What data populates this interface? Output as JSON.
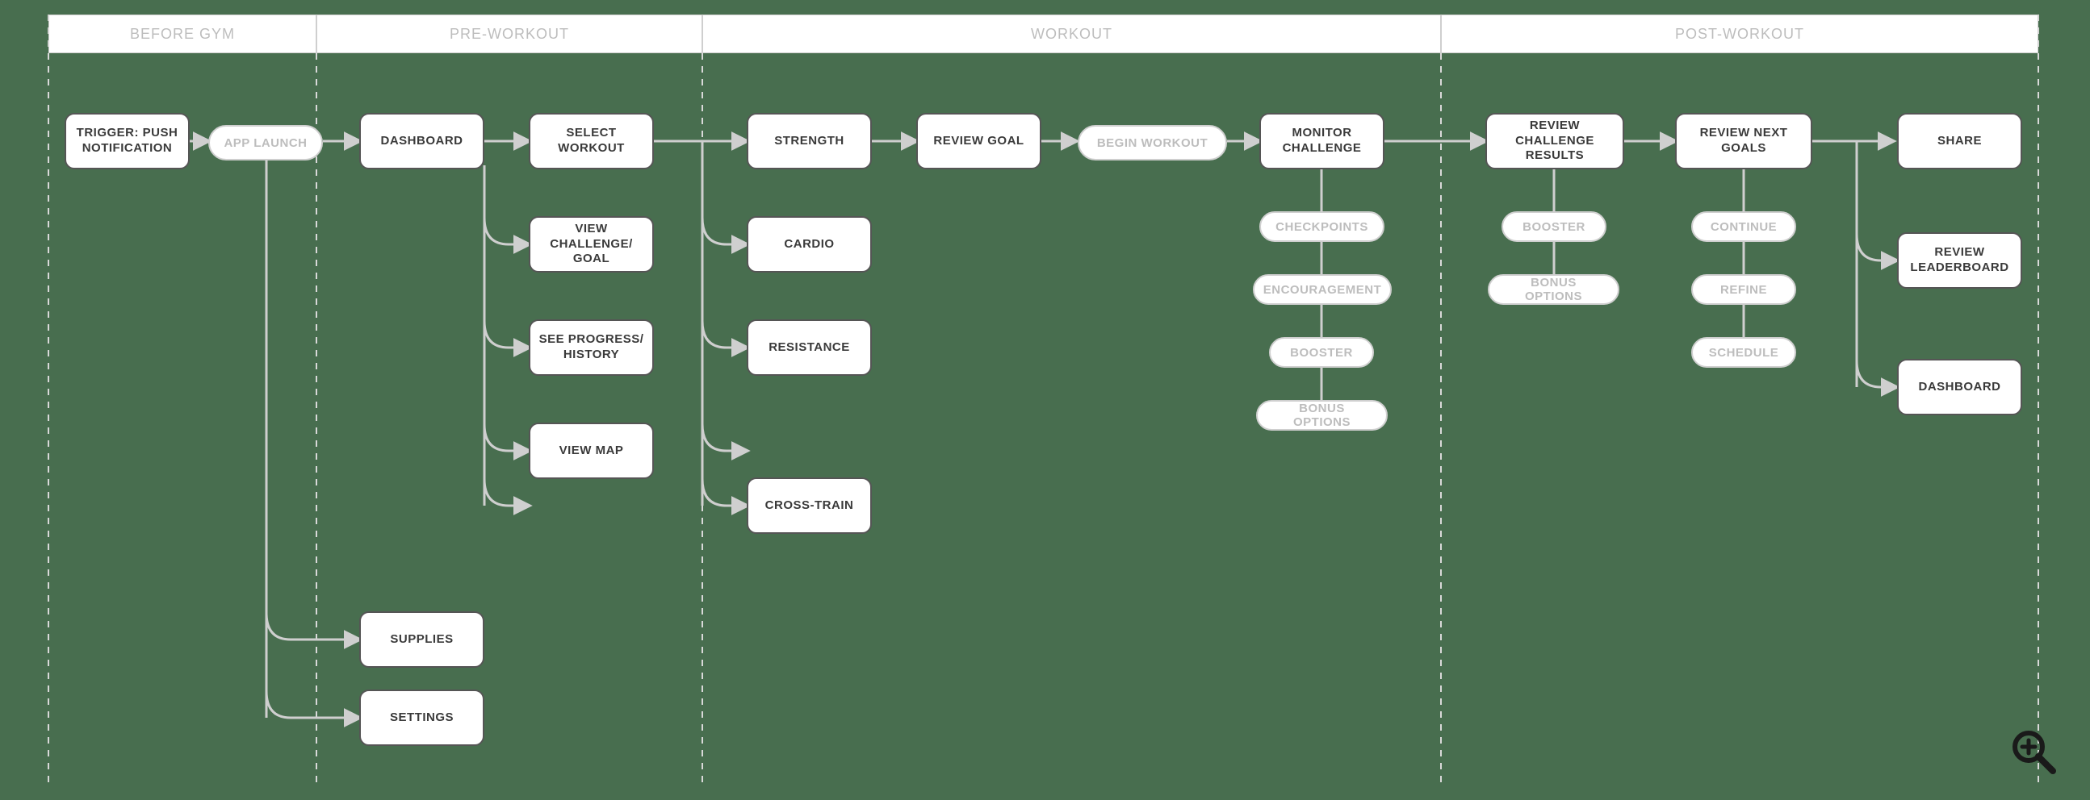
{
  "phases": {
    "before_gym": "BEFORE GYM",
    "pre_workout": "PRE-WORKOUT",
    "workout": "WORKOUT",
    "post_workout": "POST-WORKOUT"
  },
  "nodes": {
    "trigger": "TRIGGER: PUSH NOTIFICATION",
    "dashboard": "DASHBOARD",
    "select_workout": "SELECT WORKOUT",
    "view_challenge": "VIEW CHALLENGE/\nGOAL",
    "see_progress": "SEE PROGRESS/\nHISTORY",
    "view_map": "VIEW MAP",
    "supplies": "SUPPLIES",
    "settings": "SETTINGS",
    "strength": "STRENGTH",
    "cardio": "CARDIO",
    "resistance": "RESISTANCE",
    "cross_train": "CROSS-TRAIN",
    "review_goal": "REVIEW GOAL",
    "monitor_challenge": "MONITOR CHALLENGE",
    "review_results": "REVIEW CHALLENGE RESULTS",
    "review_next_goals": "REVIEW NEXT GOALS",
    "share": "SHARE",
    "review_leaderboard": "REVIEW LEADERBOARD",
    "dashboard2": "DASHBOARD"
  },
  "pills": {
    "app_launch": "APP LAUNCH",
    "begin_workout": "BEGIN WORKOUT",
    "checkpoints": "CHECKPOINTS",
    "encouragement": "ENCOURAGEMENT",
    "booster": "BOOSTER",
    "bonus_options": "BONUS OPTIONS",
    "booster2": "BOOSTER",
    "bonus_options2": "BONUS OPTIONS",
    "continue": "CONTINUE",
    "refine": "REFINE",
    "schedule": "SCHEDULE"
  }
}
